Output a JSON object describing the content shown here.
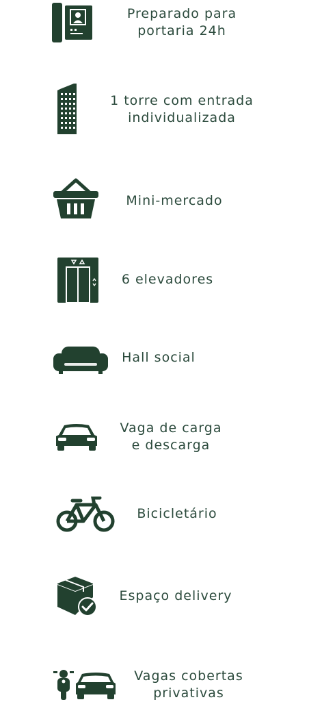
{
  "colors": {
    "icon": "#22412f",
    "text": "#2b4a3c",
    "background": "#ffffff"
  },
  "features": [
    {
      "icon": "intercom-icon",
      "line1": "Preparado para",
      "line2": "portaria 24h"
    },
    {
      "icon": "tower-icon",
      "line1": "1 torre com entrada",
      "line2": "individualizada"
    },
    {
      "icon": "basket-icon",
      "line1": "Mini-mercado",
      "line2": ""
    },
    {
      "icon": "elevator-icon",
      "line1": "6 elevadores",
      "line2": ""
    },
    {
      "icon": "sofa-icon",
      "line1": "Hall social",
      "line2": ""
    },
    {
      "icon": "car-icon",
      "line1": "Vaga de carga",
      "line2": "e descarga"
    },
    {
      "icon": "bicycle-icon",
      "line1": "Bicicletário",
      "line2": ""
    },
    {
      "icon": "delivery-box-icon",
      "line1": "Espaço delivery",
      "line2": ""
    },
    {
      "icon": "moto-car-icon",
      "line1": "Vagas cobertas",
      "line2": "privativas"
    }
  ]
}
